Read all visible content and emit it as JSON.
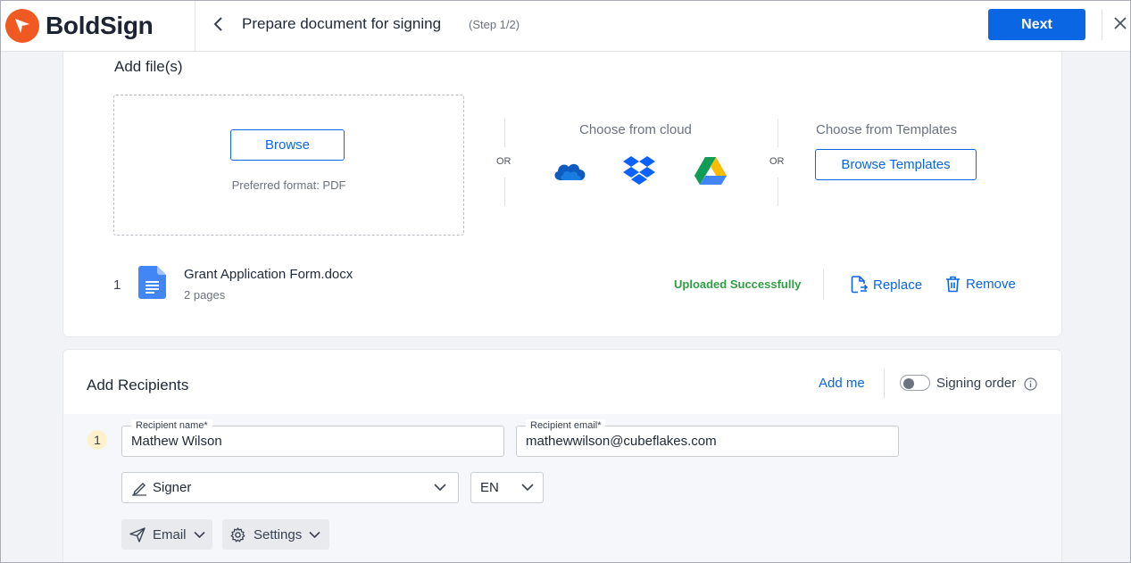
{
  "header": {
    "brand": "BoldSign",
    "title": "Prepare document for signing",
    "step": "(Step 1/2)",
    "next_label": "Next"
  },
  "files": {
    "section_title": "Add file(s)",
    "browse_label": "Browse",
    "preferred_format": "Preferred format: PDF",
    "or_label": "OR",
    "cloud_title": "Choose from cloud",
    "cloud_icons": [
      "onedrive-icon",
      "dropbox-icon",
      "google-drive-icon"
    ],
    "templates_title": "Choose from Templates",
    "browse_templates_label": "Browse Templates",
    "items": [
      {
        "index": "1",
        "name": "Grant Application Form.docx",
        "pages": "2 pages",
        "status": "Uploaded Successfully",
        "replace_label": "Replace",
        "remove_label": "Remove"
      }
    ]
  },
  "recipients": {
    "section_title": "Add Recipients",
    "add_me_label": "Add me",
    "signing_order_label": "Signing order",
    "signing_order_enabled": false,
    "list": [
      {
        "index": "1",
        "name_label": "Recipient name*",
        "name_value": "Mathew Wilson",
        "email_label": "Recipient email*",
        "email_value": "mathewwilson@cubeflakes.com",
        "role": "Signer",
        "language": "EN",
        "delivery_label": "Email",
        "settings_label": "Settings"
      }
    ]
  },
  "colors": {
    "primary": "#0b66e4",
    "brand_orange": "#f05a22",
    "success": "#2f9e44"
  }
}
